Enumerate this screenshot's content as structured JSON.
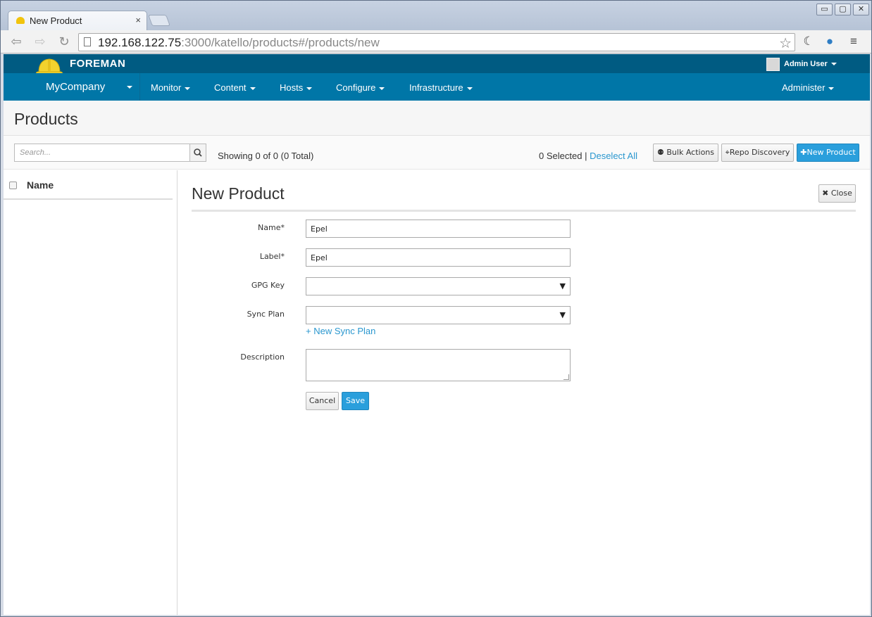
{
  "browser": {
    "tab_title": "New Product",
    "tab_close": "×",
    "url_host": "192.168.122.75",
    "url_rest": ":3000/katello/products#/products/new",
    "window_buttons": [
      "▭",
      "▢",
      "✕"
    ]
  },
  "app": {
    "brand": "FOREMAN",
    "user": "Admin User",
    "organization": "MyCompany",
    "nav": [
      "Monitor",
      "Content",
      "Hosts",
      "Configure",
      "Infrastructure"
    ],
    "administer": "Administer",
    "colors": {
      "topbar": "#005b82",
      "navbar": "#0076a7",
      "link": "#2a97cf",
      "primary": "#2a9fdc"
    }
  },
  "page": {
    "title": "Products",
    "search_placeholder": "Search...",
    "showing": "Showing 0 of 0 (0 Total)",
    "selected_count": "0 Selected",
    "separator": "|",
    "deselect_all": "Deselect All",
    "bulk_actions": "Bulk Actions",
    "repo_discovery": "Repo Discovery",
    "new_product": "New Product"
  },
  "list": {
    "column_name": "Name"
  },
  "form": {
    "title": "New Product",
    "close": "Close",
    "fields": {
      "name": {
        "label": "Name*",
        "value": "Epel"
      },
      "label": {
        "label": "Label*",
        "value": "Epel"
      },
      "gpg_key": {
        "label": "GPG Key",
        "value": ""
      },
      "sync_plan": {
        "label": "Sync Plan",
        "value": ""
      },
      "description": {
        "label": "Description",
        "value": ""
      }
    },
    "new_sync_plan": "+ New Sync Plan",
    "cancel": "Cancel",
    "save": "Save"
  }
}
